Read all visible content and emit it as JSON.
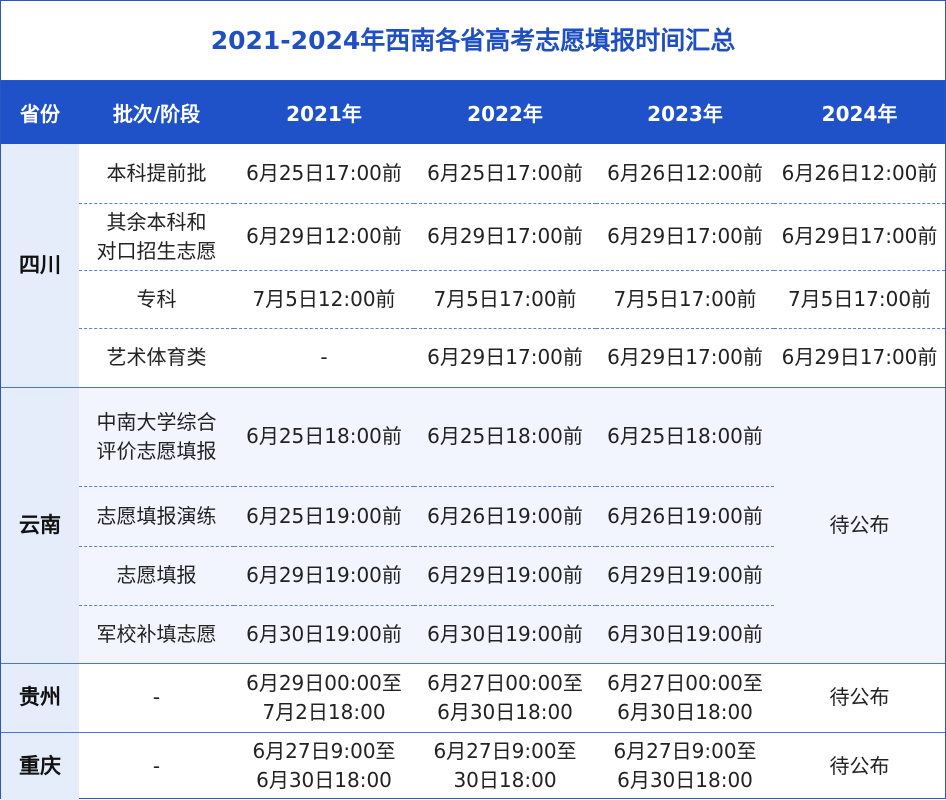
{
  "title": "2021-2024年西南各省高考志愿填报时间汇总",
  "headers": {
    "province": "省份",
    "batch": "批次/阶段",
    "y2021": "2021年",
    "y2022": "2022年",
    "y2023": "2023年",
    "y2024": "2024年"
  },
  "sichuan": {
    "name": "四川",
    "rows": [
      {
        "batch": "本科提前批",
        "y2021": "6月25日17:00前",
        "y2022": "6月25日17:00前",
        "y2023": "6月26日12:00前",
        "y2024": "6月26日12:00前"
      },
      {
        "batch_line1": "其余本科和",
        "batch_line2": "对口招生志愿",
        "y2021": "6月29日12:00前",
        "y2022": "6月29日17:00前",
        "y2023": "6月29日17:00前",
        "y2024": "6月29日17:00前"
      },
      {
        "batch": "专科",
        "y2021": "7月5日12:00前",
        "y2022": "7月5日17:00前",
        "y2023": "7月5日17:00前",
        "y2024": "7月5日17:00前"
      },
      {
        "batch": "艺术体育类",
        "y2021": "-",
        "y2022": "6月29日17:00前",
        "y2023": "6月29日17:00前",
        "y2024": "6月29日17:00前"
      }
    ]
  },
  "yunnan": {
    "name": "云南",
    "y2024": "待公布",
    "rows": [
      {
        "batch_line1": "中南大学综合",
        "batch_line2": "评价志愿填报",
        "y2021": "6月25日18:00前",
        "y2022": "6月25日18:00前",
        "y2023": "6月25日18:00前"
      },
      {
        "batch": "志愿填报演练",
        "y2021": "6月25日19:00前",
        "y2022": "6月26日19:00前",
        "y2023": "6月26日19:00前"
      },
      {
        "batch": "志愿填报",
        "y2021": "6月29日19:00前",
        "y2022": "6月29日19:00前",
        "y2023": "6月29日19:00前"
      },
      {
        "batch": "军校补填志愿",
        "y2021": "6月30日19:00前",
        "y2022": "6月30日19:00前",
        "y2023": "6月30日19:00前"
      }
    ]
  },
  "guizhou": {
    "name": "贵州",
    "batch": "-",
    "y2021_line1": "6月29日00:00至",
    "y2021_line2": "7月2日18:00",
    "y2022_line1": "6月27日00:00至",
    "y2022_line2": "6月30日18:00",
    "y2023_line1": "6月27日00:00至",
    "y2023_line2": "6月30日18:00",
    "y2024": "待公布"
  },
  "chongqing": {
    "name": "重庆",
    "batch": "-",
    "y2021_line1": "6月27日9:00至",
    "y2021_line2": "6月30日18:00",
    "y2022_line1": "6月27日9:00至",
    "y2022_line2": "30日18:00",
    "y2023_line1": "6月27日9:00至",
    "y2023_line2": "6月30日18:00",
    "y2024": "待公布"
  }
}
